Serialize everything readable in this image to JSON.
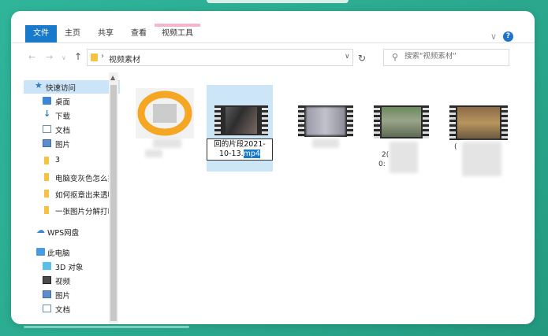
{
  "ribbon": {
    "tabs": [
      {
        "label": "文件"
      },
      {
        "label": "主页"
      },
      {
        "label": "共享"
      },
      {
        "label": "查看"
      },
      {
        "label": "视频工具"
      }
    ]
  },
  "address": {
    "path": "视频素材",
    "search_placeholder": "搜索\"视频素材\""
  },
  "nav": {
    "quick_access": "快速访问",
    "items": [
      {
        "label": "桌面",
        "pinned": true
      },
      {
        "label": "下载",
        "pinned": true
      },
      {
        "label": "文档",
        "pinned": true
      },
      {
        "label": "图片",
        "pinned": true
      },
      {
        "label": "3"
      },
      {
        "label": "电脑变灰色怎么扌"
      },
      {
        "label": "如何抠章出来透明"
      },
      {
        "label": "一张图片分解打印"
      }
    ],
    "wps": "WPS网盘",
    "this_pc": "此电脑",
    "pc_items": [
      {
        "label": "3D 对象"
      },
      {
        "label": "视频"
      },
      {
        "label": "图片"
      },
      {
        "label": "文档"
      }
    ]
  },
  "files": {
    "rename_line1": "回的片段2021-",
    "rename_line2_prefix": "10-13.",
    "rename_line2_selected": "mp4",
    "partial_label_1": "2(",
    "partial_label_1b": "0:",
    "partial_label_2": "("
  },
  "colors": {
    "accent": "#1979ca",
    "selection": "#cde6f7",
    "background": "#2aa88d"
  }
}
